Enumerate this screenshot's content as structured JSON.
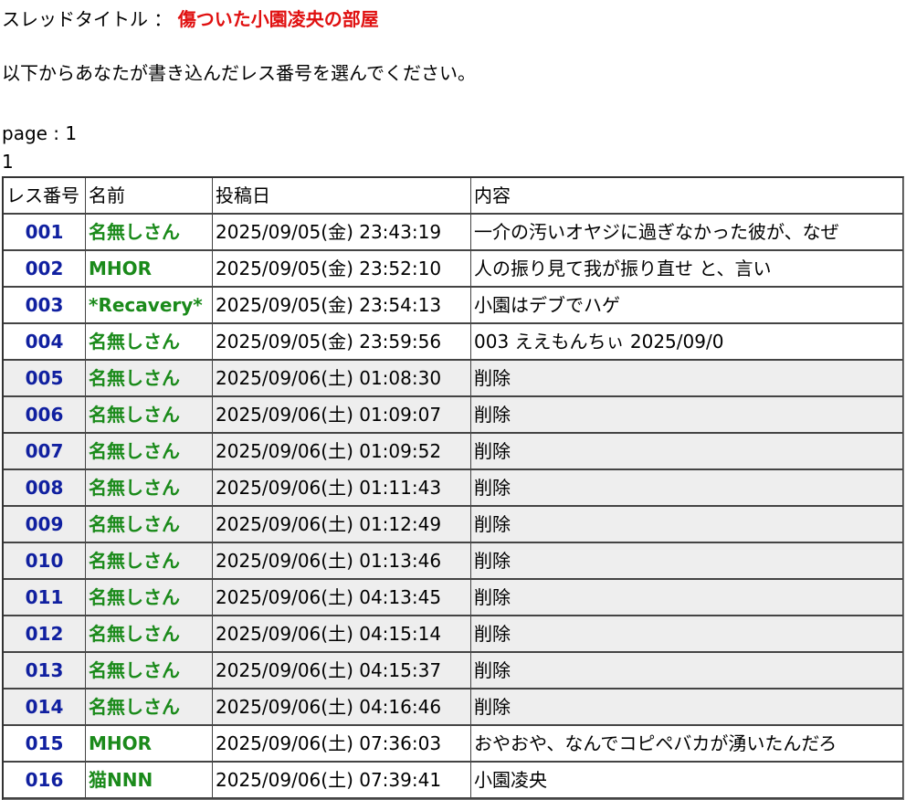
{
  "thread": {
    "label": "スレッドタイトル ： ",
    "title": "傷ついた小園凌央の部屋"
  },
  "instruction": "以下からあなたが書き込んだレス番号を選んでください。",
  "pagination": {
    "label": "page : 1",
    "pages": [
      "1"
    ]
  },
  "table": {
    "headers": [
      "レス番号",
      "名前",
      "投稿日",
      "内容"
    ],
    "rows": [
      {
        "no": "001",
        "name": "名無しさん",
        "date": "2025/09/05(金) 23:43:19",
        "content": "一介の汚いオヤジに過ぎなかった彼が、なぜ",
        "deleted": false
      },
      {
        "no": "002",
        "name": "MHOR",
        "date": "2025/09/05(金) 23:52:10",
        "content": "人の振り見て我が振り直せ と、言い",
        "deleted": false
      },
      {
        "no": "003",
        "name": "*Recavery*",
        "date": "2025/09/05(金) 23:54:13",
        "content": "小園はデブでハゲ",
        "deleted": false
      },
      {
        "no": "004",
        "name": "名無しさん",
        "date": "2025/09/05(金) 23:59:56",
        "content": "003 ええもんちぃ 2025/09/0",
        "deleted": false
      },
      {
        "no": "005",
        "name": "名無しさん",
        "date": "2025/09/06(土) 01:08:30",
        "content": "削除",
        "deleted": true
      },
      {
        "no": "006",
        "name": "名無しさん",
        "date": "2025/09/06(土) 01:09:07",
        "content": "削除",
        "deleted": true
      },
      {
        "no": "007",
        "name": "名無しさん",
        "date": "2025/09/06(土) 01:09:52",
        "content": "削除",
        "deleted": true
      },
      {
        "no": "008",
        "name": "名無しさん",
        "date": "2025/09/06(土) 01:11:43",
        "content": "削除",
        "deleted": true
      },
      {
        "no": "009",
        "name": "名無しさん",
        "date": "2025/09/06(土) 01:12:49",
        "content": "削除",
        "deleted": true
      },
      {
        "no": "010",
        "name": "名無しさん",
        "date": "2025/09/06(土) 01:13:46",
        "content": "削除",
        "deleted": true
      },
      {
        "no": "011",
        "name": "名無しさん",
        "date": "2025/09/06(土) 04:13:45",
        "content": "削除",
        "deleted": true
      },
      {
        "no": "012",
        "name": "名無しさん",
        "date": "2025/09/06(土) 04:15:14",
        "content": "削除",
        "deleted": true
      },
      {
        "no": "013",
        "name": "名無しさん",
        "date": "2025/09/06(土) 04:15:37",
        "content": "削除",
        "deleted": true
      },
      {
        "no": "014",
        "name": "名無しさん",
        "date": "2025/09/06(土) 04:16:46",
        "content": "削除",
        "deleted": true
      },
      {
        "no": "015",
        "name": "MHOR",
        "date": "2025/09/06(土) 07:36:03",
        "content": "おやおや、なんでコピペバカが湧いたんだろ",
        "deleted": false
      },
      {
        "no": "016",
        "name": "猫NNN",
        "date": "2025/09/06(土) 07:39:41",
        "content": "小園凌央",
        "deleted": false
      }
    ]
  }
}
